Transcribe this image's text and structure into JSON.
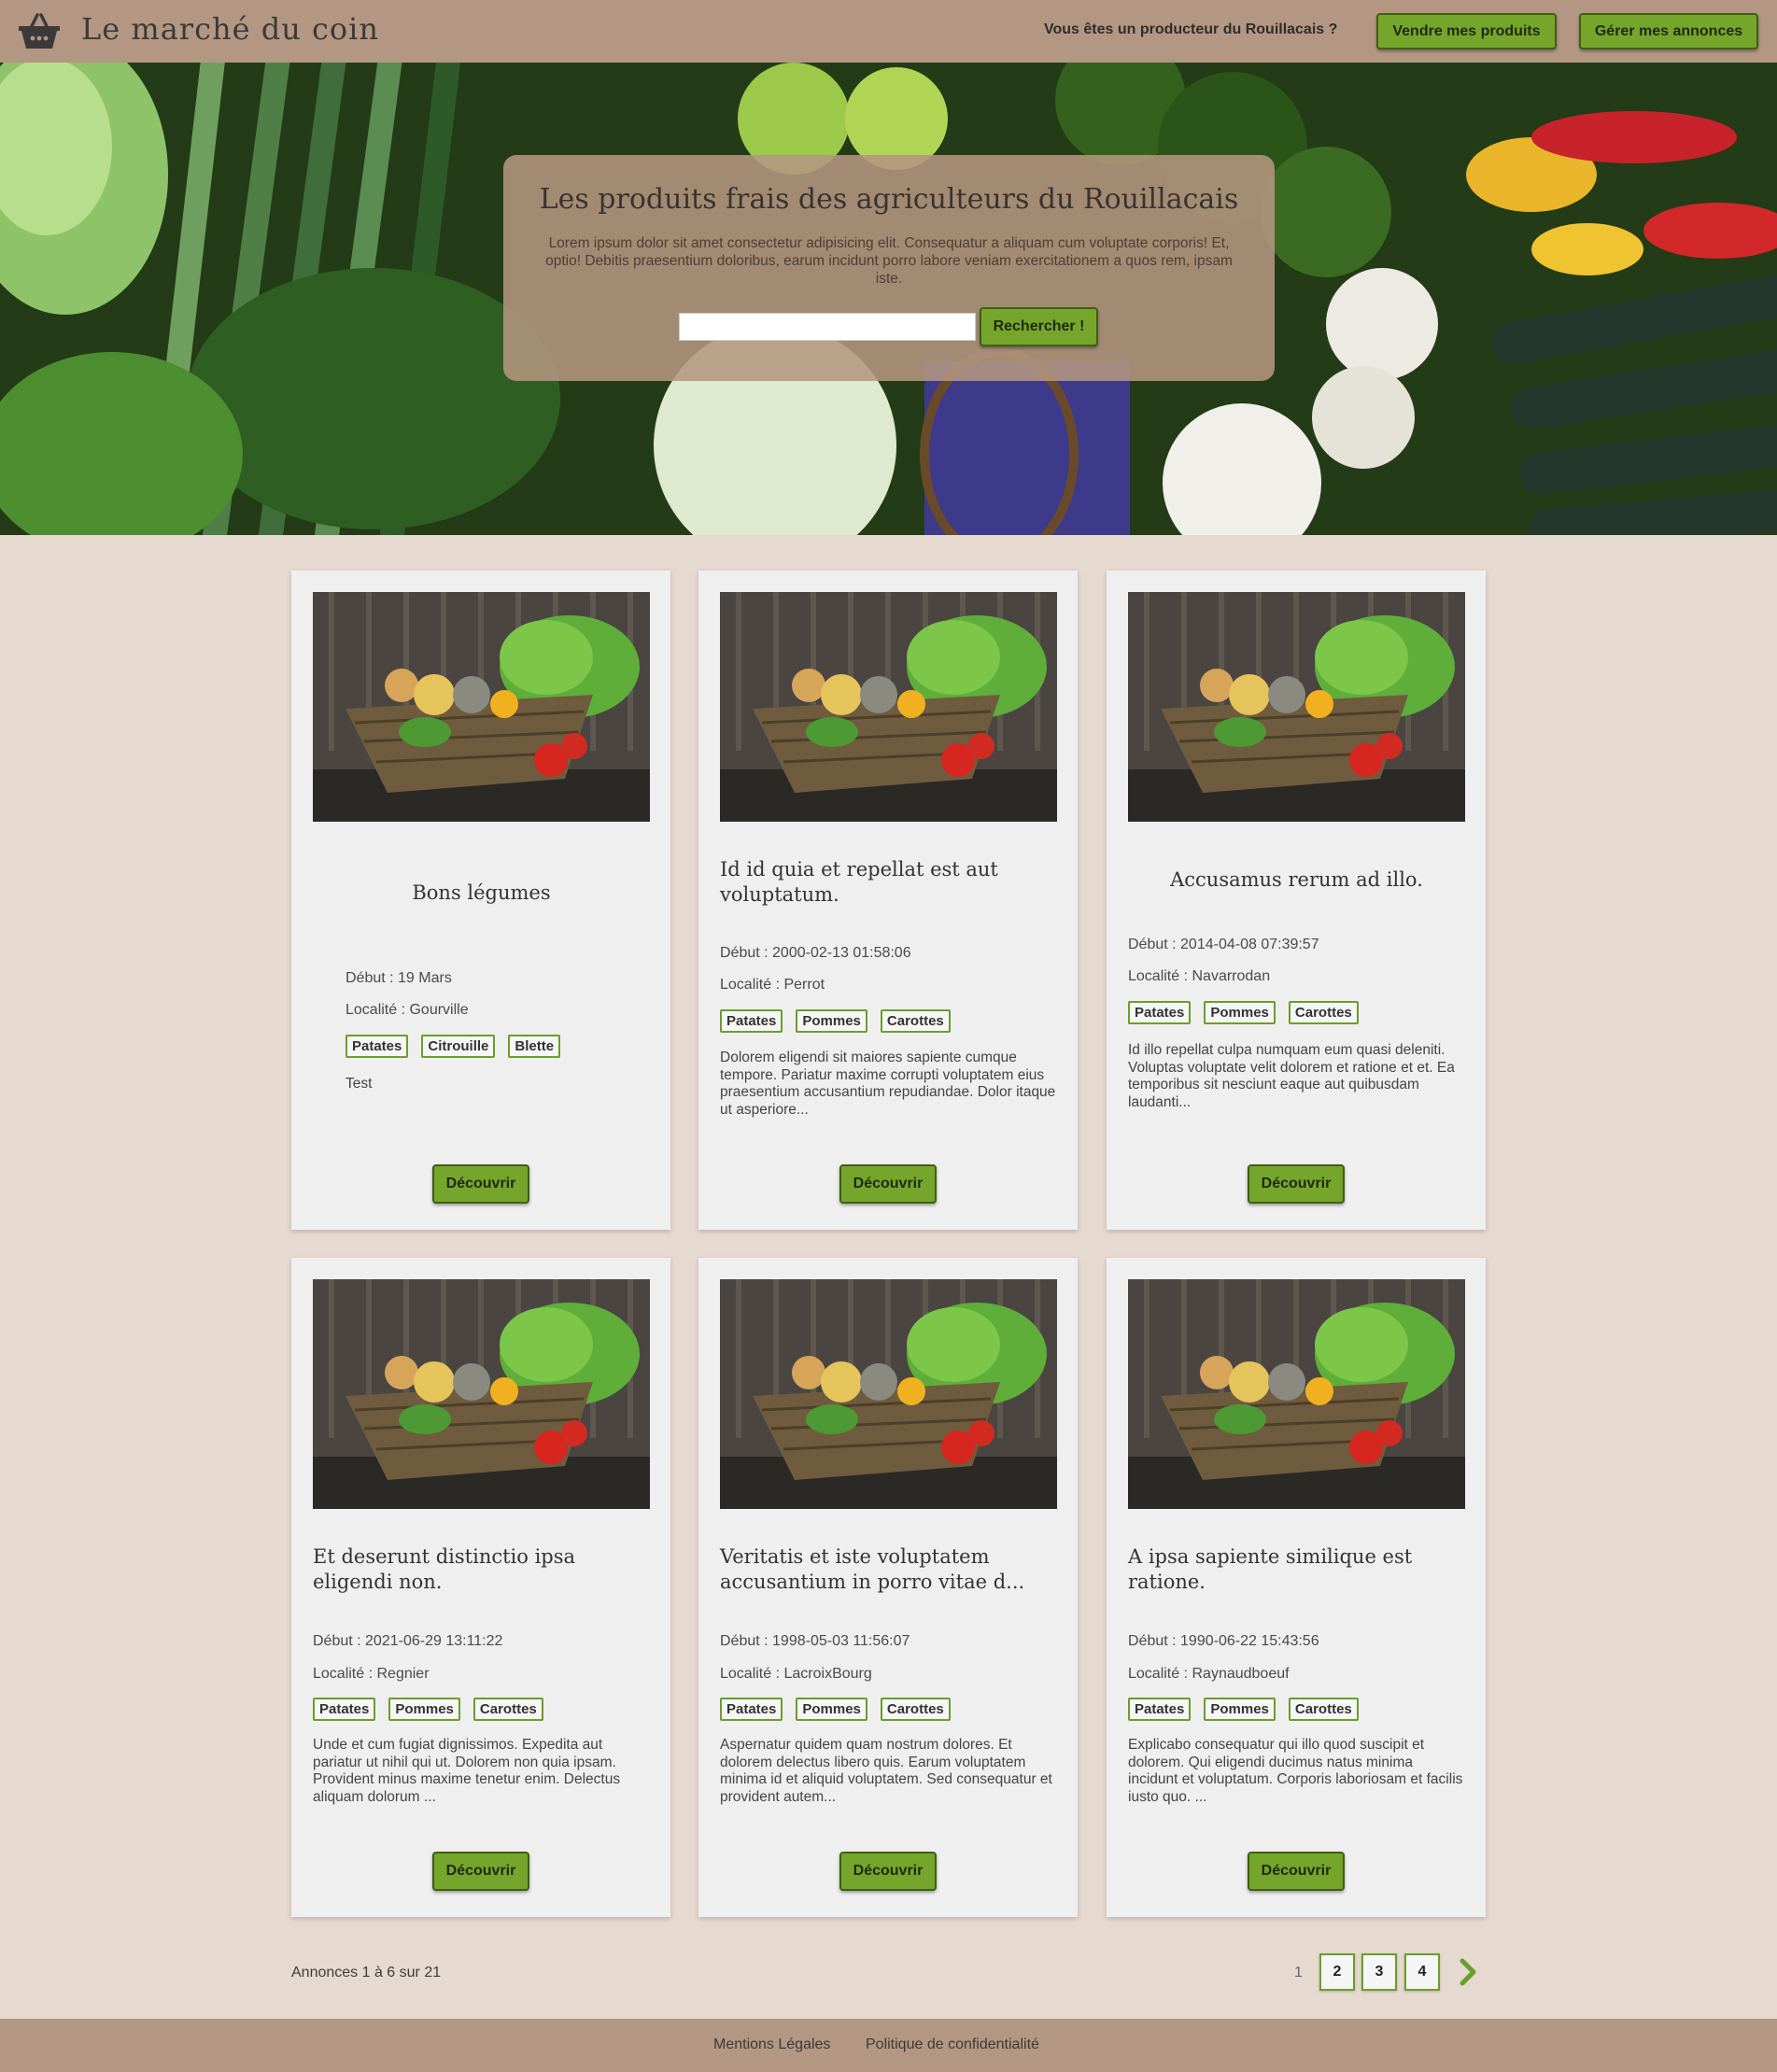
{
  "header": {
    "site_title": "Le marché du coin",
    "producer_question": "Vous êtes un producteur du Rouillacais ?",
    "sell_button": "Vendre mes produits",
    "manage_button": "Gérer mes annonces"
  },
  "hero": {
    "title": "Les produits frais des agriculteurs du Rouillacais",
    "description": "Lorem ipsum dolor sit amet consectetur adipisicing elit. Consequatur a aliquam cum voluptate corporis! Et, optio! Debitis praesentium doloribus, earum incidunt porro labore veniam exercitationem a quos rem, ipsam iste.",
    "search_value": "",
    "search_button": "Rechercher !"
  },
  "cards": [
    {
      "title": "Bons légumes",
      "start": "Début : 19 Mars",
      "locality": "Localité : Gourville",
      "tags": [
        "Patates",
        "Citrouille",
        "Blette"
      ],
      "description": "Test",
      "button": "Découvrir"
    },
    {
      "title": "Id id quia et repellat est aut voluptatum.",
      "start": "Début : 2000-02-13 01:58:06",
      "locality": "Localité : Perrot",
      "tags": [
        "Patates",
        "Pommes",
        "Carottes"
      ],
      "description": "Dolorem eligendi sit maiores sapiente cumque tempore. Pariatur maxime corrupti voluptatem eius praesentium accusantium repudiandae. Dolor itaque ut asperiore...",
      "button": "Découvrir"
    },
    {
      "title": "Accusamus rerum ad illo.",
      "start": "Début : 2014-04-08 07:39:57",
      "locality": "Localité : Navarrodan",
      "tags": [
        "Patates",
        "Pommes",
        "Carottes"
      ],
      "description": "Id illo repellat culpa numquam eum quasi deleniti. Voluptas voluptate velit dolorem et ratione et et. Ea temporibus sit nesciunt eaque aut quibusdam laudanti...",
      "button": "Découvrir"
    },
    {
      "title": "Et deserunt distinctio ipsa eligendi non.",
      "start": "Début : 2021-06-29 13:11:22",
      "locality": "Localité : Regnier",
      "tags": [
        "Patates",
        "Pommes",
        "Carottes"
      ],
      "description": "Unde et cum fugiat dignissimos. Expedita aut pariatur ut nihil qui ut. Dolorem non quia ipsam. Provident minus maxime tenetur enim. Delectus aliquam dolorum ...",
      "button": "Découvrir"
    },
    {
      "title": "Veritatis et iste voluptatem accusantium in porro vitae d...",
      "start": "Début : 1998-05-03 11:56:07",
      "locality": "Localité : LacroixBourg",
      "tags": [
        "Patates",
        "Pommes",
        "Carottes"
      ],
      "description": "Aspernatur quidem quam nostrum dolores. Et dolorem delectus libero quis. Earum voluptatem minima id et aliquid voluptatem. Sed consequatur et provident autem...",
      "button": "Découvrir"
    },
    {
      "title": "A ipsa sapiente similique est ratione.",
      "start": "Début : 1990-06-22 15:43:56",
      "locality": "Localité : Raynaudboeuf",
      "tags": [
        "Patates",
        "Pommes",
        "Carottes"
      ],
      "description": "Explicabo consequatur qui illo quod suscipit et dolorem. Qui eligendi ducimus natus minima incidunt et voluptatum. Corporis laboriosam et facilis iusto quo. ...",
      "button": "Découvrir"
    }
  ],
  "pagination": {
    "results": "Annonces 1 à 6 sur 21",
    "current": "1",
    "pages": [
      "2",
      "3",
      "4"
    ],
    "next_icon": "chevron-right-icon"
  },
  "footer": {
    "legal": "Mentions Légales",
    "privacy": "Politique de confidentialité"
  },
  "colors": {
    "header_bg": "#b39783",
    "page_bg": "#e5d9d0",
    "accent_green": "#76a52c",
    "card_bg": "#efefef"
  }
}
